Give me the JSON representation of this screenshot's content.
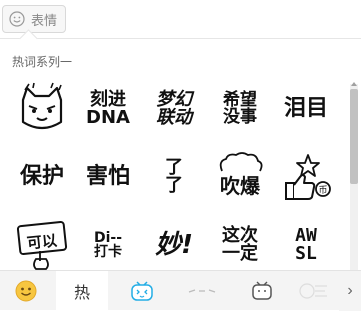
{
  "toolbar": {
    "emoji_button_label": "表情"
  },
  "panel": {
    "section_title": "热词系列一",
    "stickers": [
      {
        "name": "cat-face",
        "text": ""
      },
      {
        "name": "engraved-dna",
        "text": "刻进\nDNA"
      },
      {
        "name": "dream-collab",
        "text": "梦幻\n联动"
      },
      {
        "name": "hope-nothing",
        "text": "希望\n没事"
      },
      {
        "name": "tears",
        "text": "泪目"
      },
      {
        "name": "protect",
        "text": "保护"
      },
      {
        "name": "scared",
        "text": "害怕"
      },
      {
        "name": "yes-yes",
        "text": "了\n了"
      },
      {
        "name": "blow-up",
        "text": "吹爆"
      },
      {
        "name": "thumbs-up-coin",
        "text": ""
      },
      {
        "name": "ok",
        "text": "可以"
      },
      {
        "name": "check-in",
        "text": "Di--\n打卡"
      },
      {
        "name": "wonderful",
        "text": "妙!"
      },
      {
        "name": "this-time-sure",
        "text": "这次\n一定"
      },
      {
        "name": "awsl",
        "text": "AW\nSL"
      }
    ]
  },
  "tabs": [
    {
      "name": "emoji",
      "label": ""
    },
    {
      "name": "hot",
      "label": "热"
    },
    {
      "name": "tv-face",
      "label": ""
    },
    {
      "name": "doodle",
      "label": ""
    },
    {
      "name": "tv-small",
      "label": ""
    },
    {
      "name": "overlap",
      "label": ""
    }
  ],
  "colors": {
    "panel_bg": "#ffffff",
    "tab_bg": "#f4f4f4",
    "emoji_yellow": "#f7c640",
    "bilibili_blue": "#23ade5"
  }
}
